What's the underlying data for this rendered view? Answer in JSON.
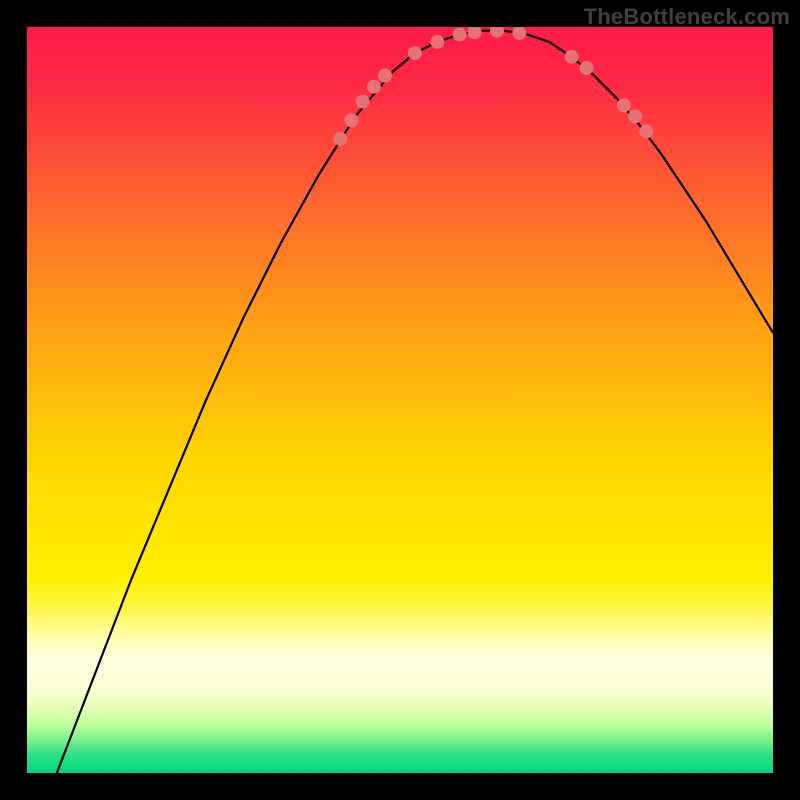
{
  "watermark": "TheBottleneck.com",
  "chart_data": {
    "type": "line",
    "title": "",
    "xlabel": "",
    "ylabel": "",
    "xlim": [
      0,
      100
    ],
    "ylim": [
      0,
      100
    ],
    "background_gradient": {
      "top_color": "#ff1a4a",
      "mid_color": "#ffd500",
      "bottom_color": "#00e07a",
      "yellow_band_y": 78,
      "green_band_y": 96
    },
    "series": [
      {
        "name": "bottleneck-curve",
        "x": [
          4,
          9,
          14,
          19,
          24,
          29,
          34,
          39,
          44,
          49,
          52,
          55,
          58,
          61,
          64,
          67,
          70,
          73,
          76,
          79,
          82,
          85,
          88,
          91,
          94,
          97,
          100
        ],
        "y": [
          0,
          13,
          26,
          38,
          50,
          61,
          71,
          80,
          88,
          94,
          96.5,
          98,
          99,
          99.5,
          99.5,
          99,
          98,
          96,
          93.5,
          90.5,
          87,
          83,
          78.5,
          74,
          69,
          64,
          59
        ]
      }
    ],
    "markers": {
      "name": "highlight-dots",
      "color": "#e57373",
      "radius": 7,
      "points": [
        {
          "x": 42,
          "y": 85
        },
        {
          "x": 43.5,
          "y": 87.5
        },
        {
          "x": 45,
          "y": 90
        },
        {
          "x": 46.5,
          "y": 92
        },
        {
          "x": 48,
          "y": 93.5
        },
        {
          "x": 52,
          "y": 96.5
        },
        {
          "x": 55,
          "y": 98
        },
        {
          "x": 58,
          "y": 99
        },
        {
          "x": 60,
          "y": 99.3
        },
        {
          "x": 63,
          "y": 99.5
        },
        {
          "x": 66,
          "y": 99.2
        },
        {
          "x": 73,
          "y": 96
        },
        {
          "x": 75,
          "y": 94.5
        },
        {
          "x": 80,
          "y": 89.5
        },
        {
          "x": 81.5,
          "y": 88
        },
        {
          "x": 83,
          "y": 86
        }
      ]
    }
  }
}
